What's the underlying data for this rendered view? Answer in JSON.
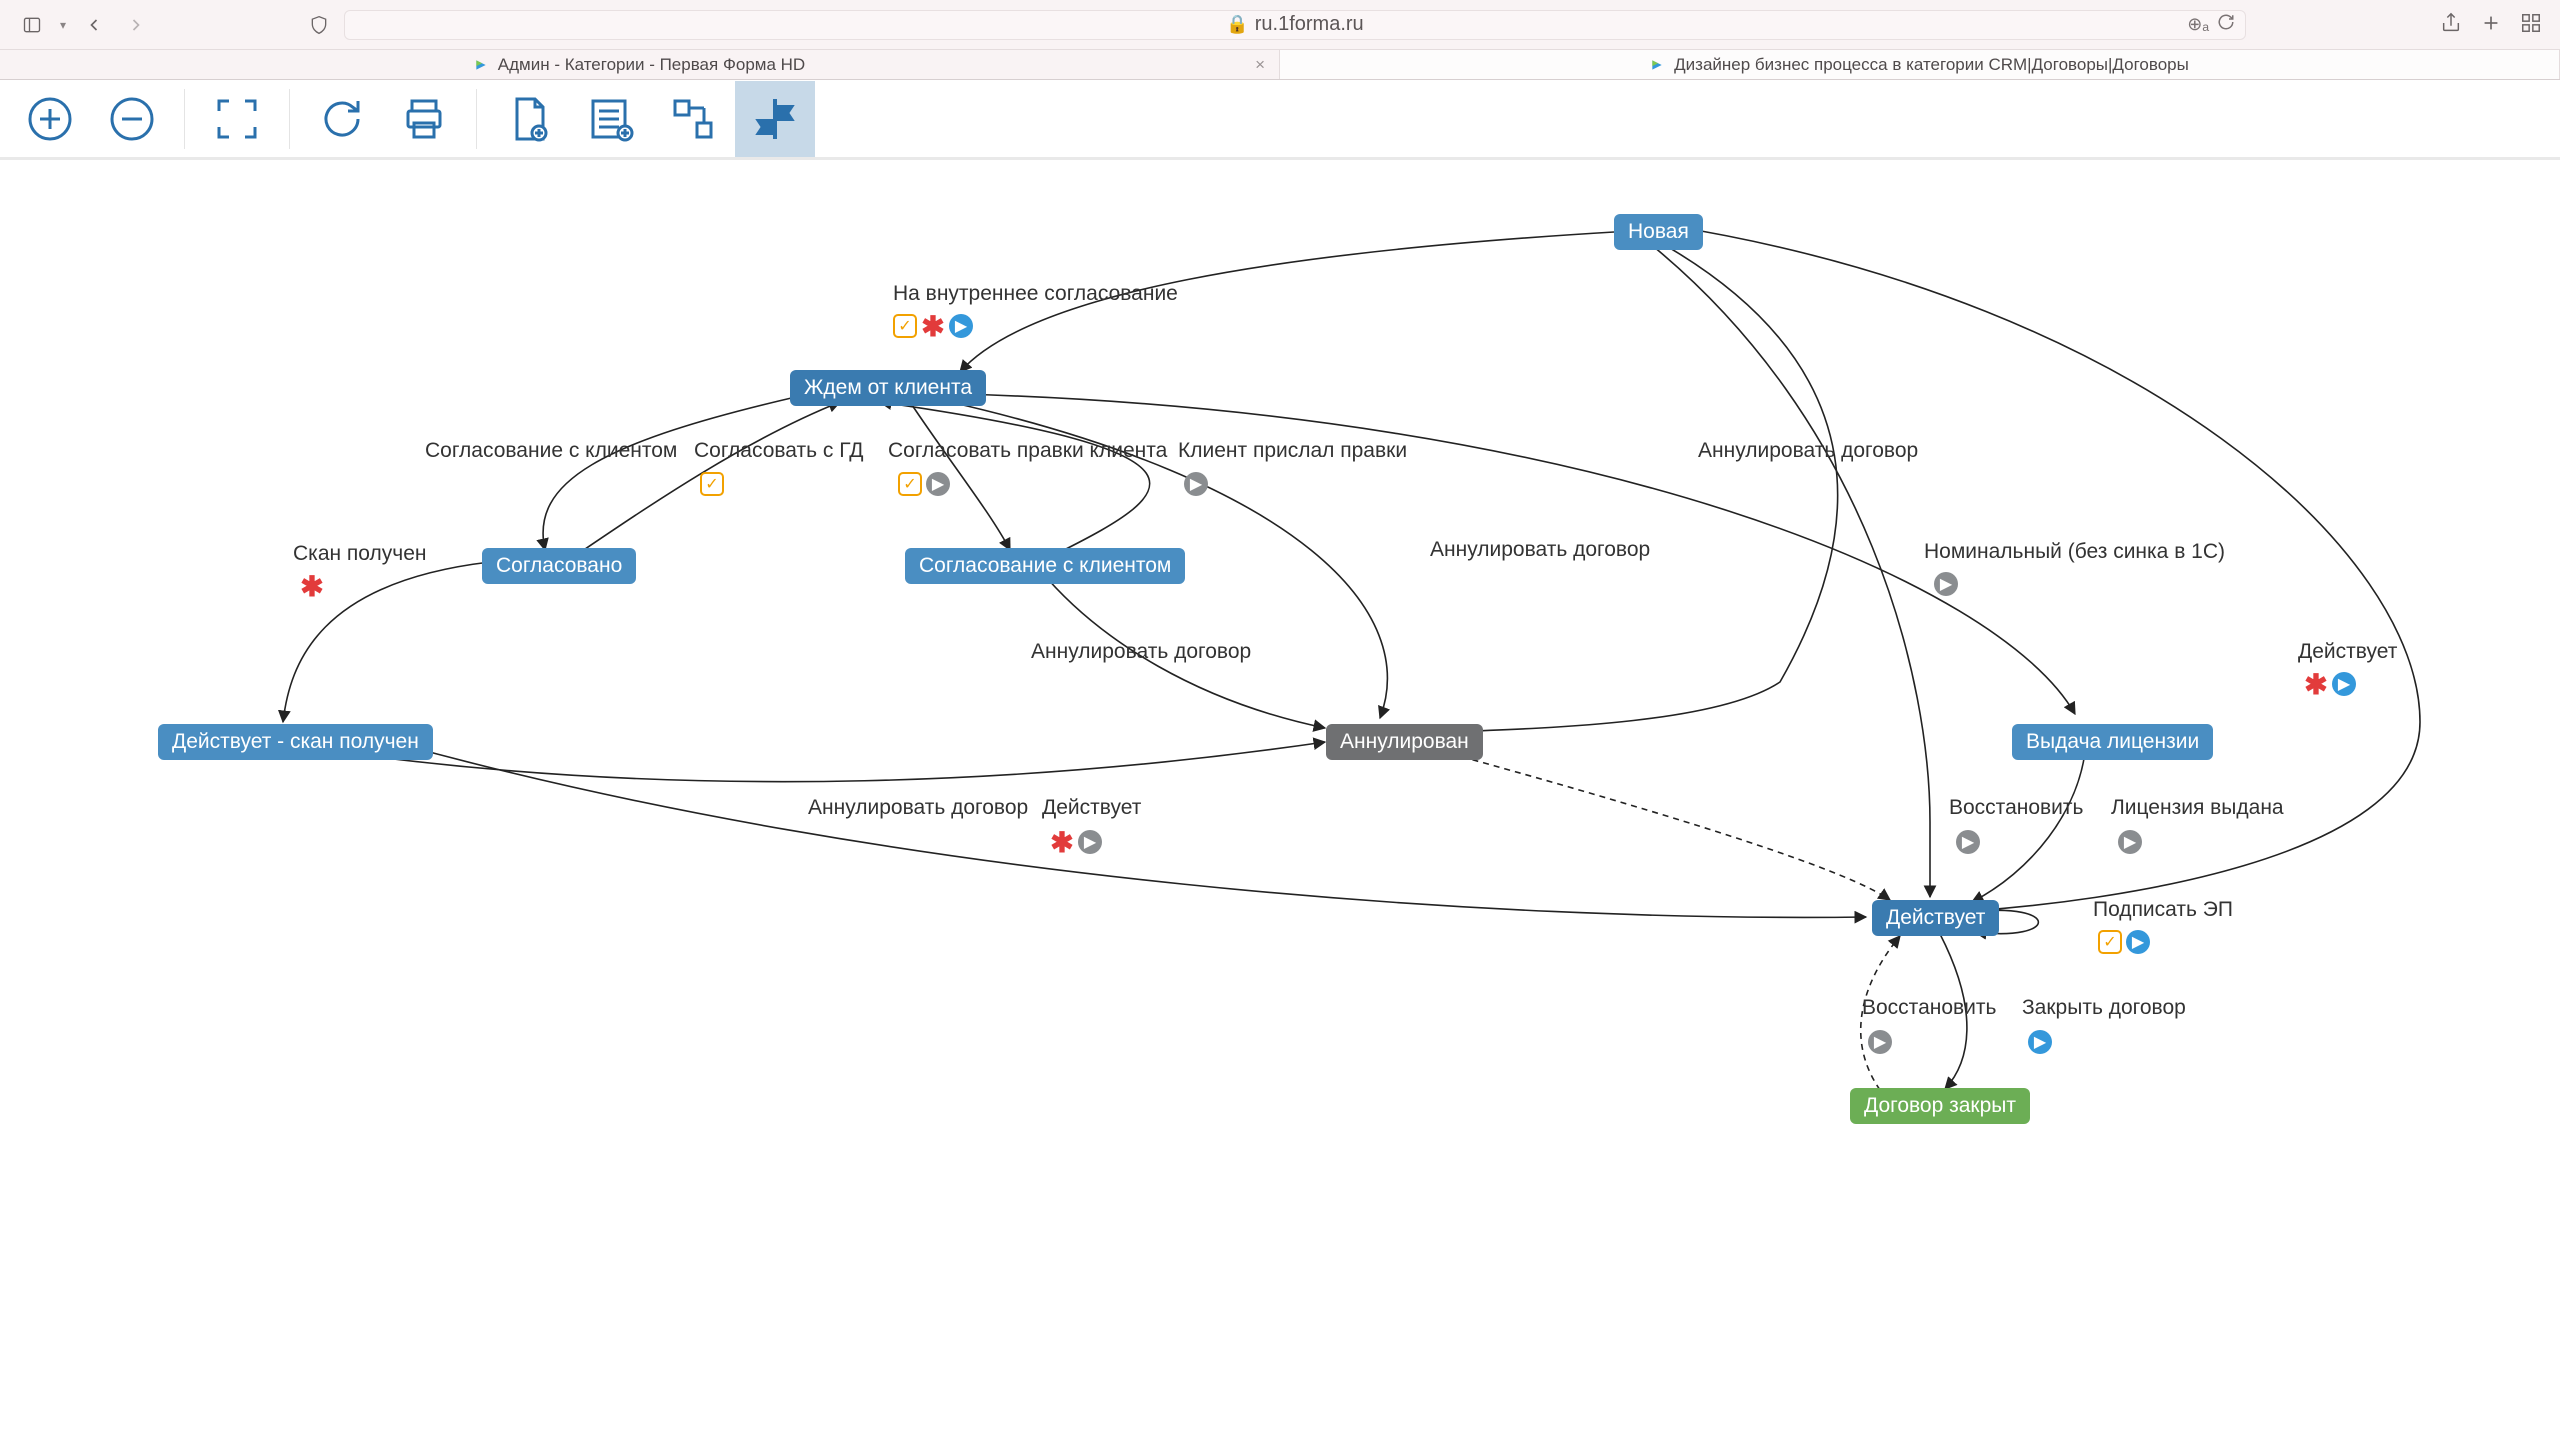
{
  "browser": {
    "url_host": "ru.1forma.ru",
    "tabs": [
      {
        "title": "Админ - Категории - Первая Форма HD"
      },
      {
        "title": "Дизайнер бизнес процесса в категории CRM|Договоры|Договоры"
      }
    ]
  },
  "toolbar": {
    "buttons": [
      {
        "name": "zoom-in"
      },
      {
        "name": "zoom-out"
      },
      {
        "name": "fit-screen"
      },
      {
        "name": "reload"
      },
      {
        "name": "print"
      },
      {
        "name": "new-document"
      },
      {
        "name": "new-list"
      },
      {
        "name": "diagram-mode"
      },
      {
        "name": "route-mode",
        "active": true
      }
    ]
  },
  "nodes": {
    "new": {
      "label": "Новая"
    },
    "wait": {
      "label": "Ждем от клиента"
    },
    "approved": {
      "label": "Согласовано"
    },
    "clientAppr": {
      "label": "Согласование с клиентом"
    },
    "annulled": {
      "label": "Аннулирован"
    },
    "actScan": {
      "label": "Действует - скан получен"
    },
    "license": {
      "label": "Выдача лицензии"
    },
    "active": {
      "label": "Действует"
    },
    "closed": {
      "label": "Договор закрыт"
    }
  },
  "edges": {
    "e1": {
      "label": "На внутреннее согласование"
    },
    "e2": {
      "label": "Согласование с клиентом"
    },
    "e3": {
      "label": "Согласовать с ГД"
    },
    "e4": {
      "label": "Согласовать правки клиента"
    },
    "e5": {
      "label": "Клиент прислал правки"
    },
    "e6": {
      "label": "Аннулировать договор"
    },
    "e7": {
      "label": "Скан получен"
    },
    "e8": {
      "label": "Аннулировать договор"
    },
    "e9": {
      "label": "Аннулировать договор"
    },
    "e10": {
      "label": "Номинальный (без синка в 1С)"
    },
    "e11": {
      "label": "Аннулировать договор"
    },
    "e12": {
      "label": "Действует"
    },
    "e13": {
      "label": "Действует"
    },
    "e14": {
      "label": "Восстановить"
    },
    "e15": {
      "label": "Лицензия выдана"
    },
    "e16": {
      "label": "Подписать ЭП"
    },
    "e17": {
      "label": "Восстановить"
    },
    "e18": {
      "label": "Закрыть договор"
    }
  }
}
